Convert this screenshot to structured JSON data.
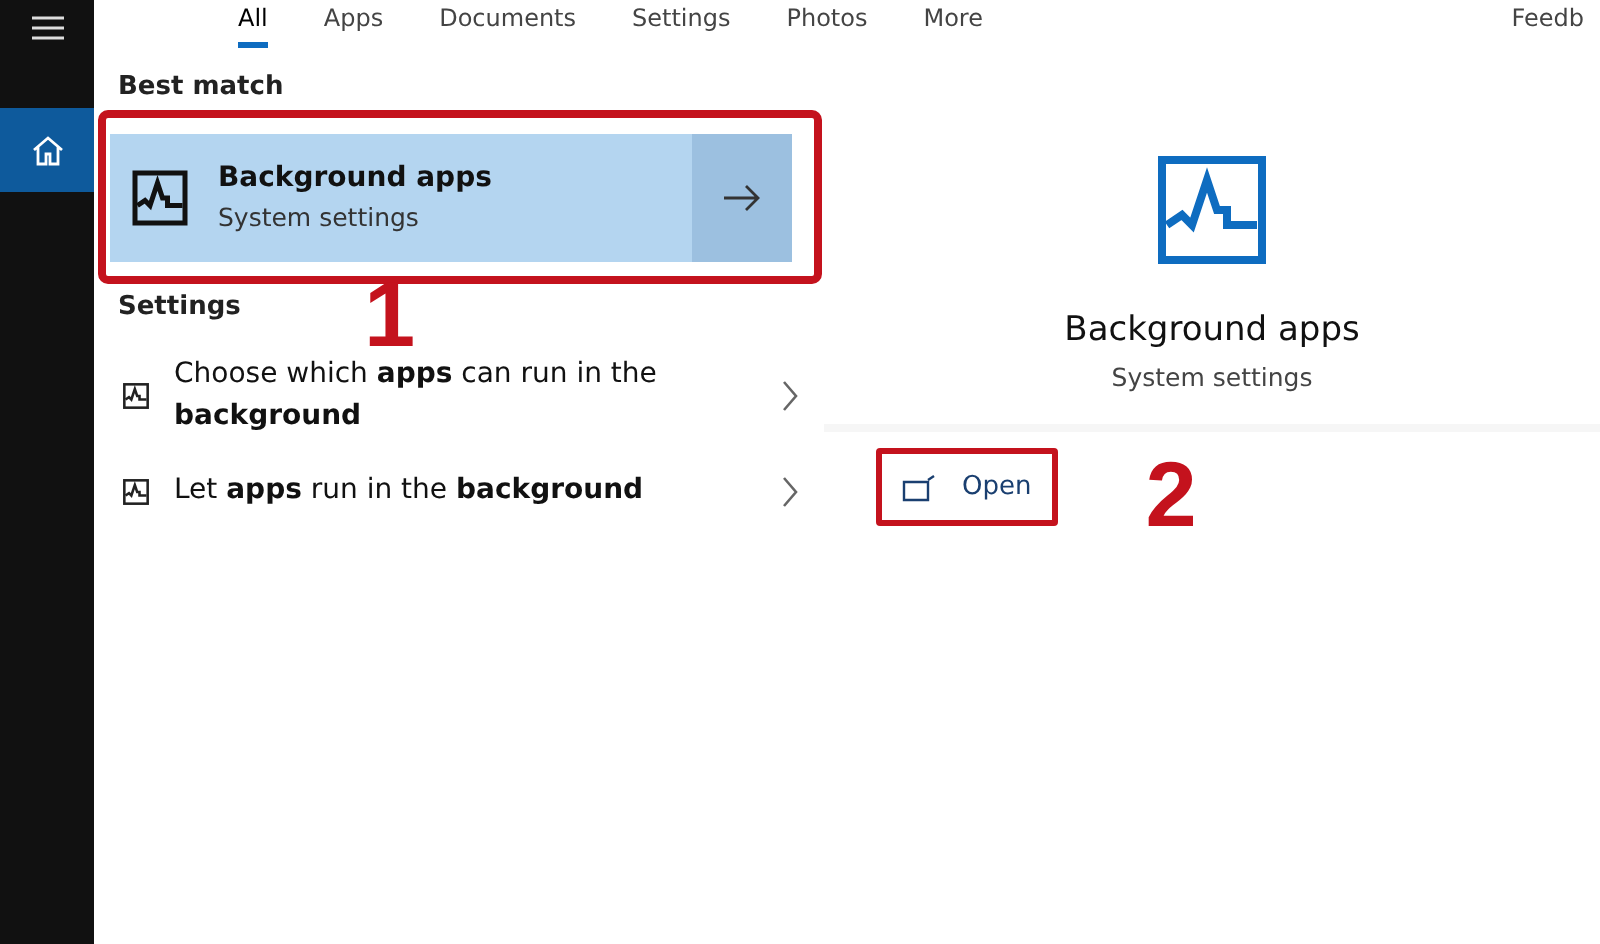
{
  "tabs": [
    {
      "label": "All",
      "selected": true
    },
    {
      "label": "Apps",
      "selected": false
    },
    {
      "label": "Documents",
      "selected": false
    },
    {
      "label": "Settings",
      "selected": false
    },
    {
      "label": "Photos",
      "selected": false
    },
    {
      "label": "More",
      "selected": false
    }
  ],
  "feedback": "Feedb",
  "best_match": {
    "heading": "Best match",
    "title": "Background apps",
    "subtitle": "System settings",
    "callout": "1"
  },
  "settings": {
    "heading": "Settings",
    "items": [
      {
        "text": "Choose which **apps** can run in the **background**"
      },
      {
        "text": "Let **apps** run in the **background**"
      }
    ]
  },
  "preview": {
    "title": "Background apps",
    "subtitle": "System settings",
    "open": "Open",
    "callout": "2"
  }
}
